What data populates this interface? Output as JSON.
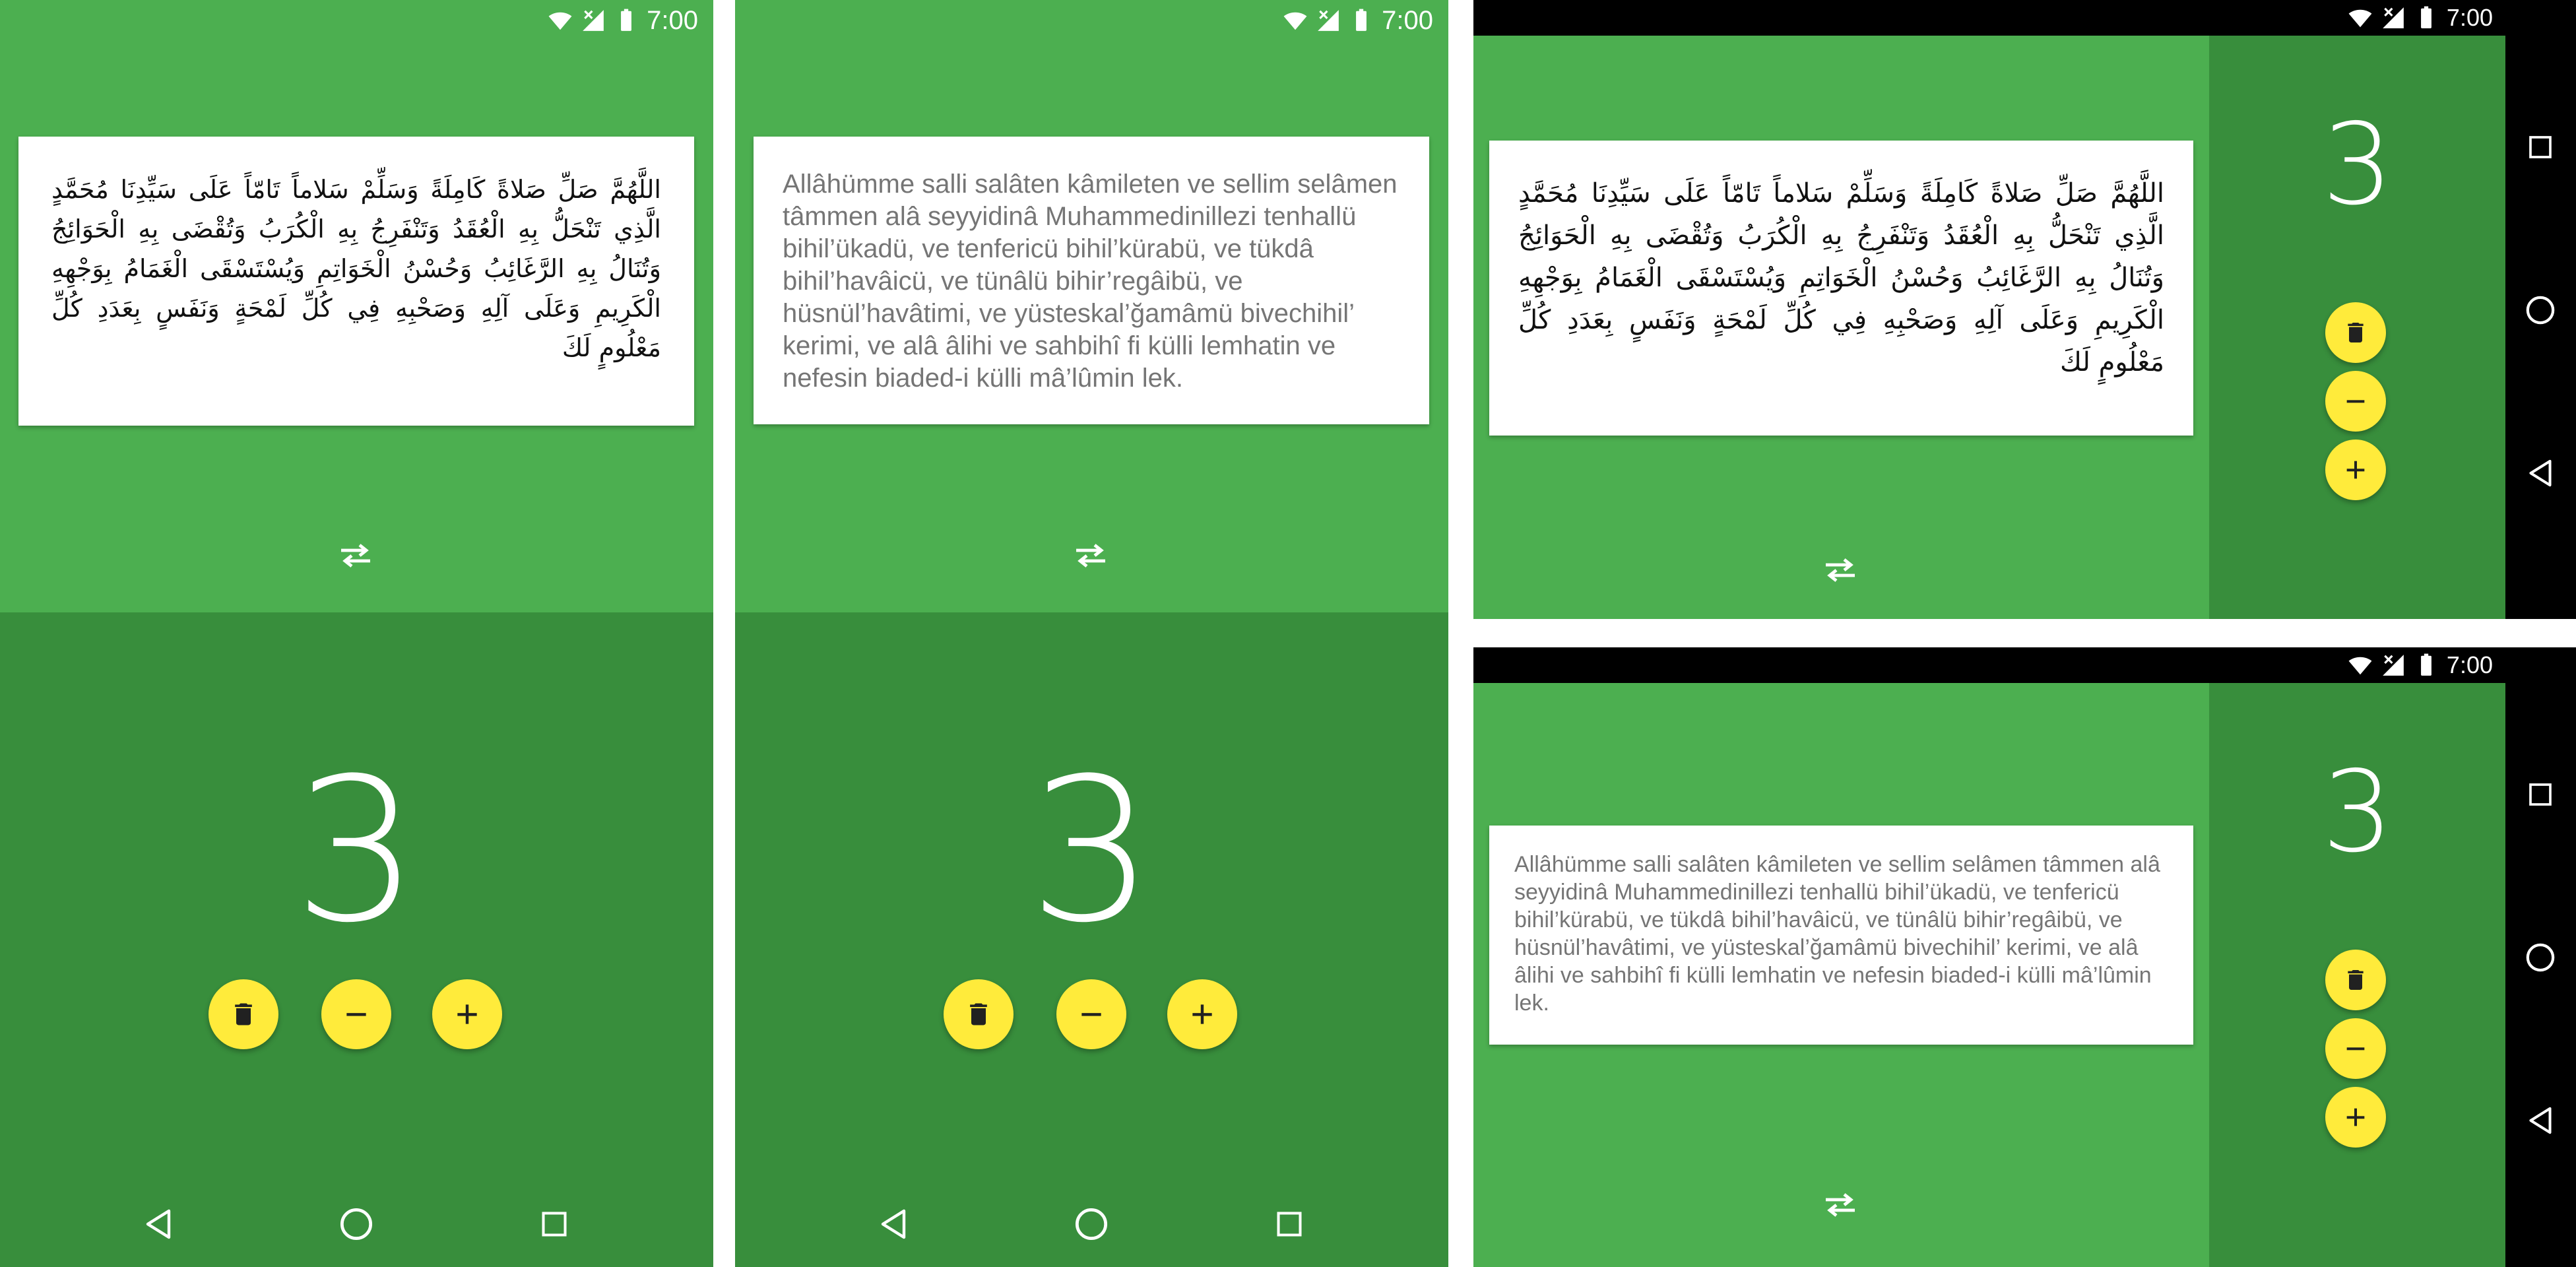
{
  "status": {
    "time": "7:00"
  },
  "dua": {
    "arabic": "اللَّهُمَّ صَلِّ صَلاةً كَامِلَةً وَسَلِّمْ سَلاماً تَامّاً عَلَى سَيِّدِنَا مُحَمَّدٍ الَّذِي تَنْحَلُّ بِهِ الْعُقَدُ وَتَنْفَرِجُ بِهِ الْكُرَبُ وَتُقْضَى بِهِ الْحَوَائِجُ وَتُنَالُ بِهِ الرَّغَائِبُ وَحُسْنُ الْخَوَاتِمِ وَيُسْتَسْقَى الْغَمَامُ بِوَجْهِهِ الْكَرِيمِ وَعَلَى آلِهِ وَصَحْبِهِ فِي كُلِّ لَمْحَةٍ وَنَفَسٍ بِعَدَدِ كُلِّ مَعْلُومٍ لَكَ",
    "transliteration": "Allâhümme salli salâten kâmileten ve sellim selâmen tâmmen alâ seyyidinâ Muhammedinillezi tenhallü bihil’ükadü, ve tenfericü bihil’kürabü, ve tükdâ bihil’havâicü, ve tünâlü bihir’regâibü, ve hüsnül’havâtimi, ve yüsteskal’ğamâmü bivechihil’ kerimi, ve alâ âlihi ve sahbihî fi külli lemhatin ve nefesin biaded-i külli mâ’lûmin lek."
  },
  "counter": {
    "value": "3"
  },
  "icons": {
    "swap": "swap-horiz-icon",
    "delete": "delete-icon",
    "minus": "remove-icon",
    "plus": "add-icon",
    "back": "back-triangle-icon",
    "home": "home-circle-icon",
    "recents": "recents-square-icon"
  },
  "colors": {
    "primary": "#4caf50",
    "primary_dark": "#388e3c",
    "accent": "#ffeb3b",
    "nav_black": "#000000"
  }
}
